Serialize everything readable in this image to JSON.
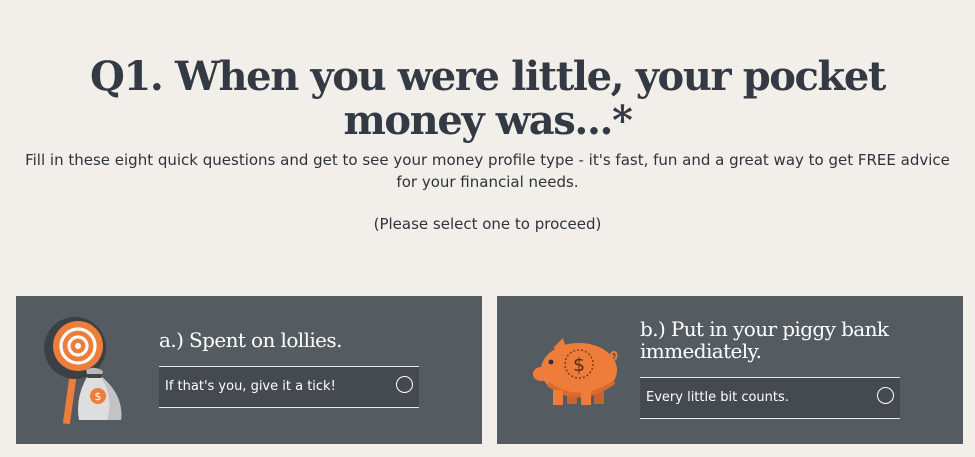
{
  "question": {
    "title_line1": "Q1. When you were little, your pocket",
    "title_line2": "money was...*"
  },
  "intro_text": "Fill in these eight quick questions and get to see your money profile type - it's fast, fun and a great way to get FREE advice for your financial needs.",
  "instruction_text": "(Please select one to proceed)",
  "options": [
    {
      "label": "a.) Spent on lollies.",
      "tick_text": "If that's you, give it a tick!",
      "icon": "lollipop-moneybag-icon",
      "dollar_symbol": "$"
    },
    {
      "label": "b.) Put in your piggy bank immediately.",
      "tick_text": "Every little bit counts.",
      "icon": "piggy-bank-icon",
      "dollar_symbol": "$"
    }
  ],
  "colors": {
    "background": "#f2efeb",
    "card": "#555c61",
    "heading": "#333a44",
    "accent": "#ee7d3b"
  }
}
